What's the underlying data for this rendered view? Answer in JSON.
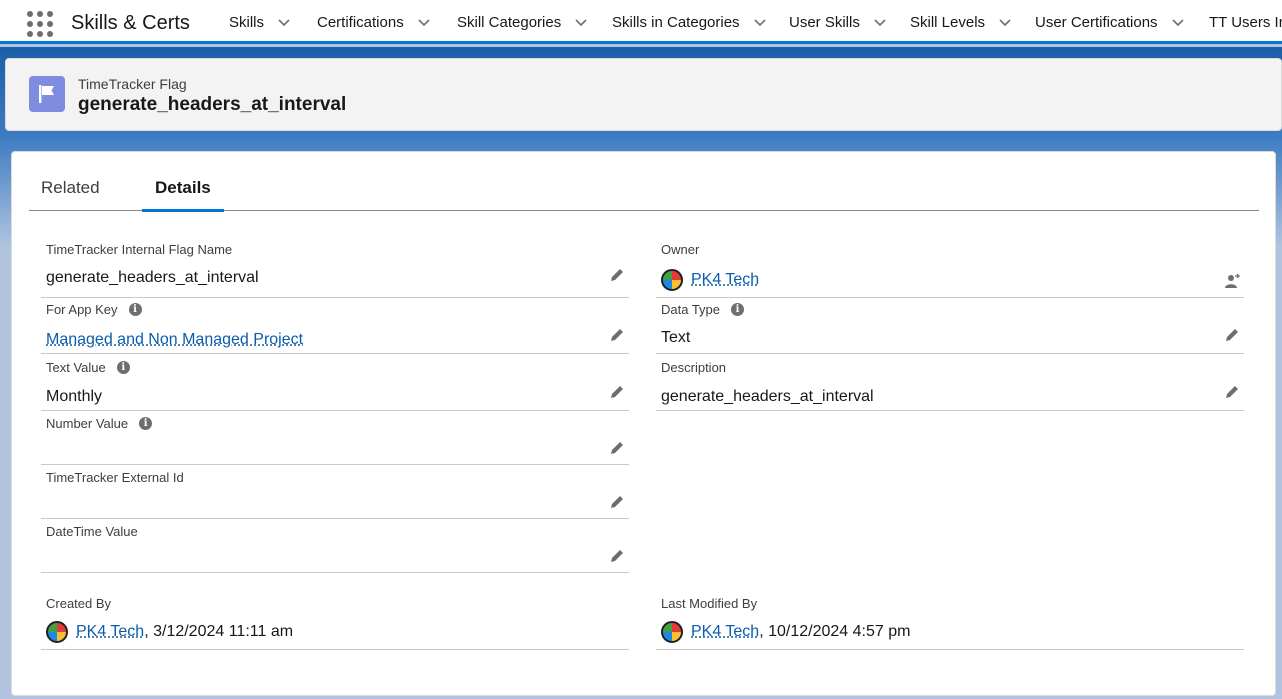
{
  "app": {
    "name": "Skills & Certs",
    "nav_items": [
      {
        "label": "Skills"
      },
      {
        "label": "Certifications"
      },
      {
        "label": "Skill Categories"
      },
      {
        "label": "Skills in Categories"
      },
      {
        "label": "User Skills"
      },
      {
        "label": "Skill Levels"
      },
      {
        "label": "User Certifications"
      },
      {
        "label": "TT Users In"
      }
    ]
  },
  "record": {
    "type": "TimeTracker Flag",
    "title": "generate_headers_at_interval",
    "icon": "flag-icon",
    "icon_color": "#7f8de1"
  },
  "tabs": [
    {
      "label": "Related",
      "active": false
    },
    {
      "label": "Details",
      "active": true
    }
  ],
  "fields": {
    "internal_flag_name": {
      "label": "TimeTracker Internal Flag Name",
      "value": "generate_headers_at_interval"
    },
    "owner": {
      "label": "Owner",
      "value": "PK4 Tech"
    },
    "for_app_key": {
      "label": "For App Key",
      "value": "Managed and Non Managed Project"
    },
    "data_type": {
      "label": "Data Type",
      "value": "Text"
    },
    "text_value": {
      "label": "Text Value",
      "value": "Monthly"
    },
    "description": {
      "label": "Description",
      "value": "generate_headers_at_interval"
    },
    "number_value": {
      "label": "Number Value",
      "value": ""
    },
    "external_id": {
      "label": "TimeTracker External Id",
      "value": ""
    },
    "datetime_value": {
      "label": "DateTime Value",
      "value": ""
    },
    "created_by": {
      "label": "Created By",
      "user": "PK4 Tech",
      "timestamp": ", 3/12/2024 11:11 am"
    },
    "last_modified_by": {
      "label": "Last Modified By",
      "user": "PK4 Tech",
      "timestamp": ", 10/12/2024 4:57 pm"
    }
  },
  "colors": {
    "brand_blue": "#0176d3",
    "link": "#0b5cab"
  }
}
